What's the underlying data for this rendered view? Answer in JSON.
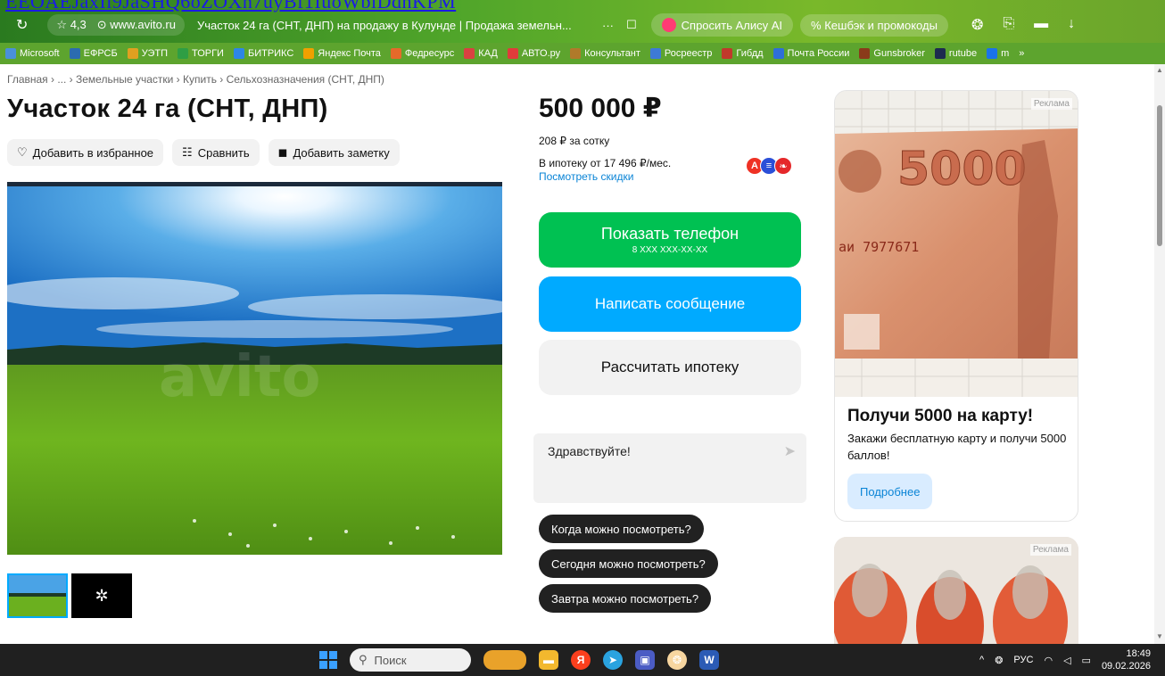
{
  "overlay": {
    "text": "EEOAEJaxIl9JaSHQ6oZOXh7uyBf1IuoWbiDdhKPM"
  },
  "browser": {
    "rating": "4,3",
    "domain": "www.avito.ru",
    "tab_title": "Участок 24 га (СНТ, ДНП) на продажу в Кулунде | Продажа земельн...",
    "dots": "···",
    "alice_label": "Спросить Алису AI",
    "cashback_label": "Кешбэк и промокоды"
  },
  "bookmarks": [
    {
      "label": "Microsoft",
      "color": "#4a90d9"
    },
    {
      "label": "ЕФРСБ",
      "color": "#2b6cb0"
    },
    {
      "label": "УЭТП",
      "color": "#e0a020"
    },
    {
      "label": "ТОРГИ",
      "color": "#2f9e44"
    },
    {
      "label": "БИТРИКС",
      "color": "#2d86e6"
    },
    {
      "label": "Яндекс Почта",
      "color": "#f0a000"
    },
    {
      "label": "Федресурс",
      "color": "#e56a2a"
    },
    {
      "label": "КАД",
      "color": "#d94141"
    },
    {
      "label": "АВТО.ру",
      "color": "#e03b3b"
    },
    {
      "label": "Консультант",
      "color": "#b07a2a"
    },
    {
      "label": "Росреестр",
      "color": "#3d7ad6"
    },
    {
      "label": "Гибдд",
      "color": "#c0392b"
    },
    {
      "label": "Почта России",
      "color": "#2e6fd8"
    },
    {
      "label": "Gunsbroker",
      "color": "#8a3a1a"
    },
    {
      "label": "rutube",
      "color": "#1d2b4f"
    },
    {
      "label": "m",
      "color": "#1a73e8"
    },
    {
      "label": "»",
      "color": ""
    }
  ],
  "page": {
    "breadcrumb": "Главная › ... › Земельные участки › Купить › Сельхозназначения (СНТ, ДНП)",
    "title": "Участок 24 га (СНТ, ДНП)",
    "actions": {
      "favorite": "Добавить в избранное",
      "compare": "Сравнить",
      "note": "Добавить заметку"
    },
    "price": "500 000 ₽",
    "price_per_sotka": "208 ₽ за сотку",
    "mortgage": "В ипотеку от 17 496 ₽/мес.",
    "discounts": "Посмотреть скидки",
    "phone_button": "Показать телефон",
    "phone_mask": "8 XXX XXX-XX-XX",
    "message_button": "Написать сообщение",
    "calc_button": "Рассчитать ипотеку",
    "chat_greeting": "Здравствуйте!",
    "quick_questions": [
      "Когда можно посмотреть?",
      "Сегодня можно посмотреть?",
      "Завтра можно посмотреть?"
    ]
  },
  "ad": {
    "label": "Реклама",
    "banknote_value": "5000",
    "serial": "аи 7977671",
    "heading": "Получи 5000 на карту!",
    "text": "Закажи бесплатную карту и получи 5000 баллов!",
    "button": "Подробнее"
  },
  "ad2": {
    "label": "Реклама"
  },
  "taskbar": {
    "search_placeholder": "Поиск",
    "lang": "РУС",
    "time": "18:49",
    "date": "09.02.2026"
  },
  "colors": {
    "green_button": "#00c152",
    "blue_button": "#00aaff",
    "link": "#0a84d6"
  }
}
